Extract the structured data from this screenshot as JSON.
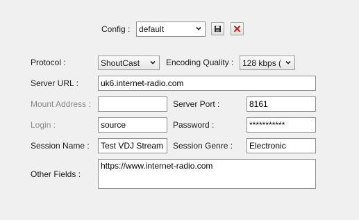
{
  "config": {
    "label": "Config :",
    "selected": "default",
    "save_icon": "floppy-disk-icon",
    "delete_icon": "red-x-icon"
  },
  "protocol": {
    "label": "Protocol :",
    "selected": "ShoutCast"
  },
  "encoding": {
    "label": "Encoding Quality :",
    "selected": "128 kbps ("
  },
  "server_url": {
    "label": "Server URL :",
    "value": "uk6.internet-radio.com"
  },
  "mount_address": {
    "label": "Mount Address :",
    "value": ""
  },
  "server_port": {
    "label": "Server Port :",
    "value": "8161"
  },
  "login": {
    "label": "Login :",
    "value": "source"
  },
  "password": {
    "label": "Password :",
    "value": "***********"
  },
  "session_name": {
    "label": "Session Name :",
    "value": "Test VDJ Stream"
  },
  "session_genre": {
    "label": "Session Genre :",
    "value": "Electronic"
  },
  "other_fields": {
    "label": "Other Fields :",
    "value": "https://www.internet-radio.com"
  },
  "colors": {
    "background": "#f0f0f0",
    "disabled_label": "#8a8a8a",
    "delete_red": "#cc2222"
  }
}
